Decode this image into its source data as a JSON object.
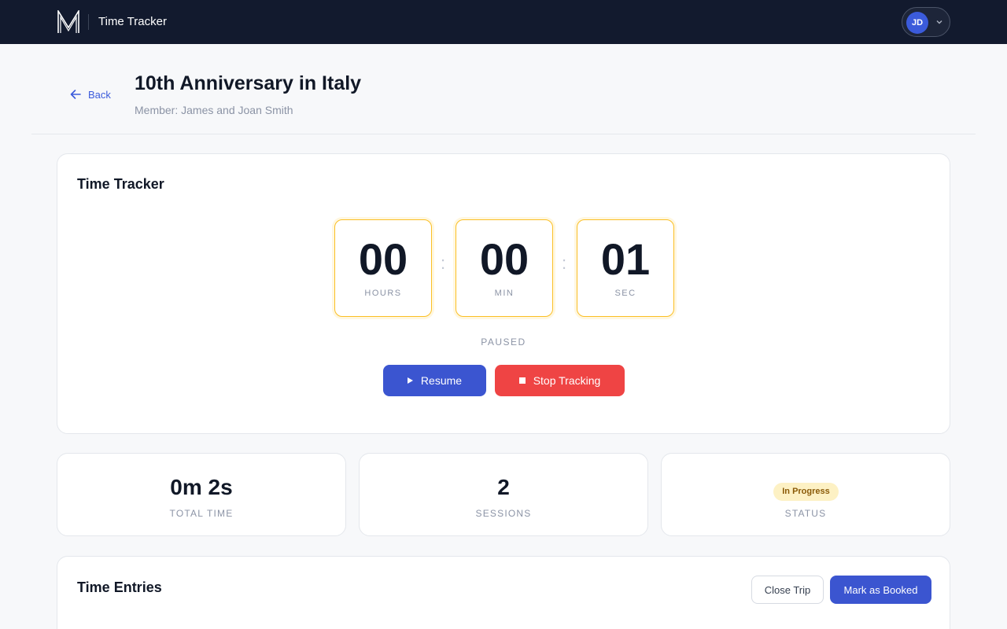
{
  "header": {
    "app_title": "Time Tracker",
    "user_initials": "JD",
    "accent": "#3b5bdb",
    "bg": "#121a2e"
  },
  "page": {
    "back_label": "Back",
    "title": "10th Anniversary in Italy",
    "subtitle": "Member: James and Joan Smith"
  },
  "tracker": {
    "title": "Time Tracker",
    "hours": "00",
    "hours_label": "HOURS",
    "minutes": "00",
    "minutes_label": "MIN",
    "seconds": "01",
    "seconds_label": "SEC",
    "separator": ":",
    "state": "PAUSED",
    "resume_label": "Resume",
    "stop_label": "Stop Tracking",
    "resume_color": "#3b55d0",
    "stop_color": "#ef4444"
  },
  "stats": [
    {
      "value": "0m 2s",
      "label": "TOTAL TIME"
    },
    {
      "value": "2",
      "label": "SESSIONS"
    },
    {
      "badge": "In Progress",
      "label": "STATUS",
      "badge_color": "#fdf1c4"
    }
  ],
  "entries": {
    "title": "Time Entries",
    "close_label": "Close Trip",
    "booked_label": "Mark as Booked"
  },
  "icons": [
    "logo-m-icon",
    "chevron-down-icon",
    "arrow-left-icon",
    "play-icon",
    "stop-icon"
  ]
}
